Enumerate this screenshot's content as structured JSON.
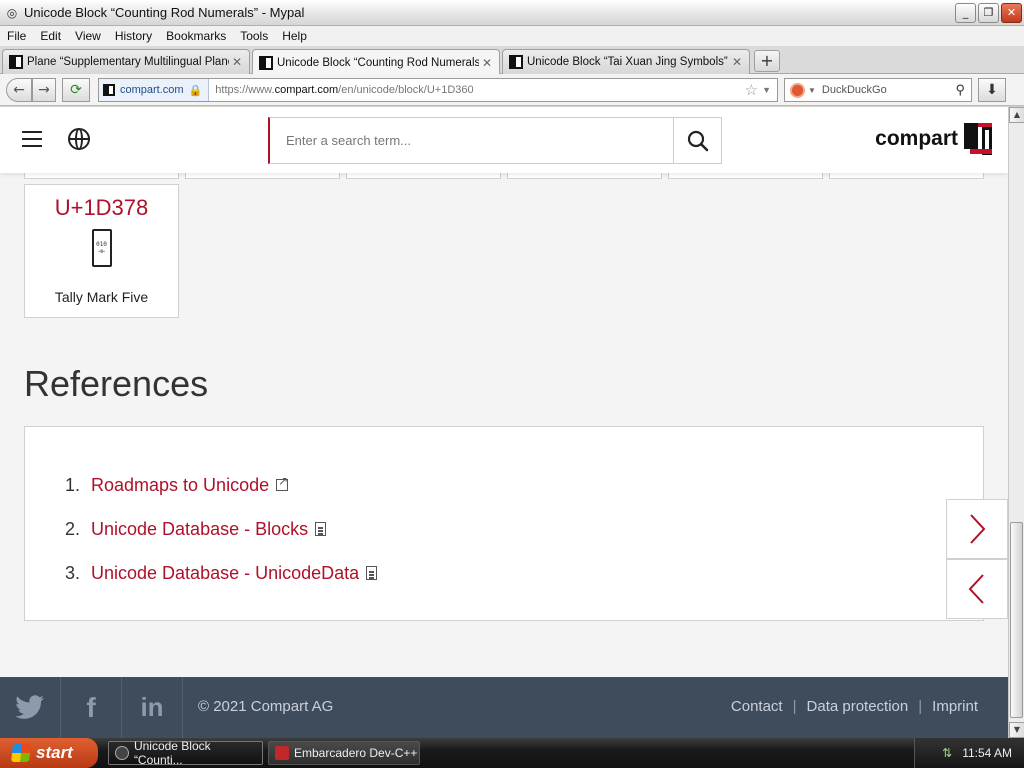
{
  "window": {
    "title": "Unicode Block “Counting Rod Numerals” - Mypal",
    "minimize": "_",
    "maximize": "❐",
    "close": "✕"
  },
  "menu": [
    "File",
    "Edit",
    "View",
    "History",
    "Bookmarks",
    "Tools",
    "Help"
  ],
  "tabs": [
    {
      "label": "Plane “Supplementary Multilingual Plane”",
      "active": false
    },
    {
      "label": "Unicode Block “Counting Rod Numerals”",
      "active": true
    },
    {
      "label": "Unicode Block “Tai Xuan Jing Symbols”",
      "active": false
    }
  ],
  "newtab_label": "+",
  "nav": {
    "back": "←",
    "forward": "→",
    "reload": "⟳",
    "identity": "compart.com",
    "url_prefix": "https://www.",
    "url_domain": "compart.com",
    "url_path": "/en/unicode/block/U+1D360",
    "search_engine_placeholder": "DuckDuckGo"
  },
  "site": {
    "search_placeholder": "Enter a search term...",
    "logo_text": "compart"
  },
  "card": {
    "code": "U+1D378",
    "glyph_text": "010\n⊣⊢",
    "name": "Tally Mark Five"
  },
  "references": {
    "title": "References",
    "items": [
      {
        "num": "1.",
        "label": "Roadmaps to Unicode",
        "icon": "external-link-icon"
      },
      {
        "num": "2.",
        "label": "Unicode Database - Blocks",
        "icon": "document-icon"
      },
      {
        "num": "3.",
        "label": "Unicode Database - UnicodeData",
        "icon": "document-icon"
      }
    ]
  },
  "footer": {
    "copyright": "© 2021 Compart AG",
    "links": [
      "Contact",
      "Data protection",
      "Imprint"
    ],
    "separator": "|",
    "social": [
      "twitter-icon",
      "facebook-icon",
      "linkedin-icon"
    ]
  },
  "taskbar": {
    "start": "start",
    "tasks": [
      {
        "label": "Unicode Block “Counti...",
        "active": true
      },
      {
        "label": "Embarcadero Dev-C++",
        "active": false
      }
    ],
    "clock": "11:54 AM"
  },
  "colors": {
    "accent": "#b0102a",
    "footer_bg": "#3f4c5c",
    "page_bg": "#f4f4f4"
  }
}
